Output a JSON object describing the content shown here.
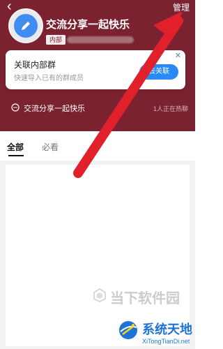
{
  "nav": {
    "back_icon": "‹",
    "manage_label": "管理"
  },
  "group": {
    "title": "交流分享一起快乐",
    "badge": "内部"
  },
  "link_card": {
    "title": "关联内部群",
    "subtitle": "快速导入已有的群成员",
    "button": "去关联",
    "close_icon": "✕"
  },
  "chat_row": {
    "label": "交流分享一起快乐",
    "status": "1人正在热聊"
  },
  "tabs": [
    {
      "label": "全部"
    },
    {
      "label": "必看"
    }
  ],
  "watermark": {
    "text": "当下软件园"
  },
  "site_badge": {
    "title": "系统天地",
    "url": "XiTongTianDi.net"
  },
  "colors": {
    "header": "#7a2230",
    "accent": "#2a8af4",
    "arrow": "#e0202a"
  }
}
